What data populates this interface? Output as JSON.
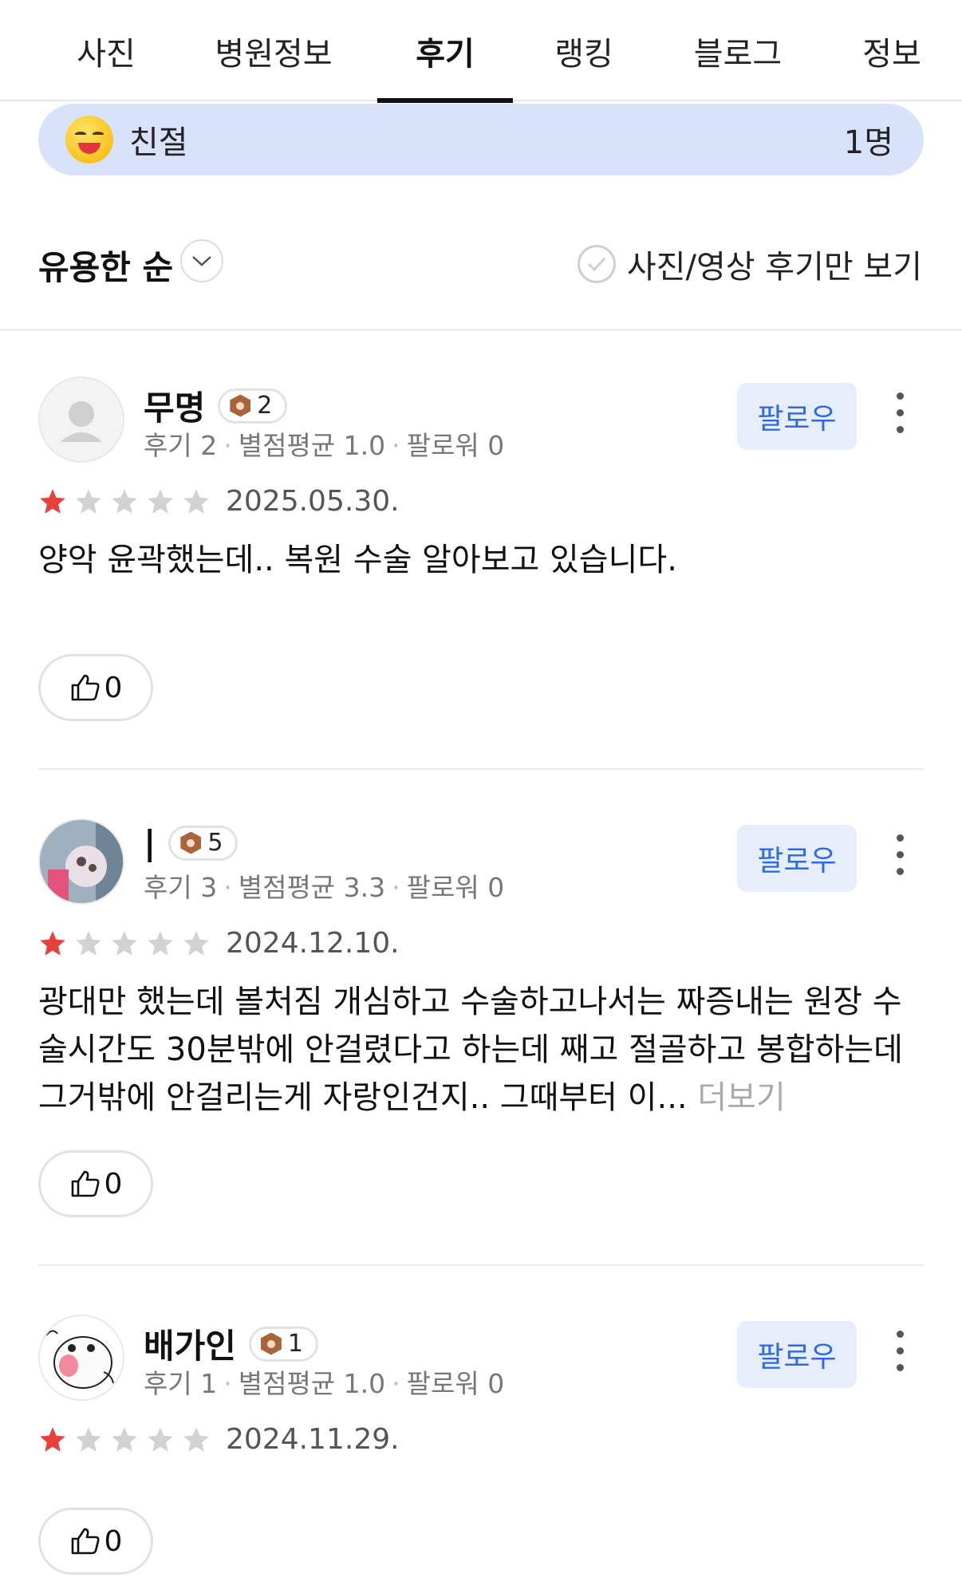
{
  "tabs": [
    {
      "label": "사진",
      "active": false
    },
    {
      "label": "병원정보",
      "active": false
    },
    {
      "label": "후기",
      "active": true
    },
    {
      "label": "랭킹",
      "active": false
    },
    {
      "label": "블로그",
      "active": false
    },
    {
      "label": "정보",
      "active": false
    }
  ],
  "keyword_pill": {
    "emoji_icon": "grinning-face-icon",
    "label": "친절",
    "count": "1명"
  },
  "sort": {
    "label": "유용한 순",
    "filter_label": "사진/영상 후기만 보기"
  },
  "colors": {
    "accent": "#2f6ae0",
    "follow_bg": "#e6edfb",
    "pill_bg": "#d8e3fb",
    "star_on": "#e8413d",
    "star_off": "#d2d2d2"
  },
  "reviews": [
    {
      "name": "무명",
      "level": "2",
      "meta": {
        "reviews": "후기 2",
        "rating_avg": "별점평균 1.0",
        "followers": "팔로워 0"
      },
      "follow_label": "팔로우",
      "stars": 1,
      "date": "2025.05.30.",
      "text": "양악 윤곽했는데.. 복원 수술 알아보고 있습니다.",
      "more_label": "",
      "likes": "0"
    },
    {
      "name": "|",
      "level": "5",
      "meta": {
        "reviews": "후기 3",
        "rating_avg": "별점평균 3.3",
        "followers": "팔로워 0"
      },
      "follow_label": "팔로우",
      "stars": 1,
      "date": "2024.12.10.",
      "text": "광대만 했는데 볼처짐 개심하고 수술하고나서는  짜증내는 원장 수술시간도 30분밖에 안걸렸다고 하는데 째고 절골하고 봉합하는데 그거밖에 안걸리는게 자랑인건지.. 그때부터 이...",
      "more_label": "더보기",
      "likes": "0"
    },
    {
      "name": "배가인",
      "level": "1",
      "meta": {
        "reviews": "후기 1",
        "rating_avg": "별점평균 1.0",
        "followers": "팔로워 0"
      },
      "follow_label": "팔로우",
      "stars": 1,
      "date": "2024.11.29.",
      "text": "",
      "more_label": "",
      "likes": "0"
    }
  ]
}
